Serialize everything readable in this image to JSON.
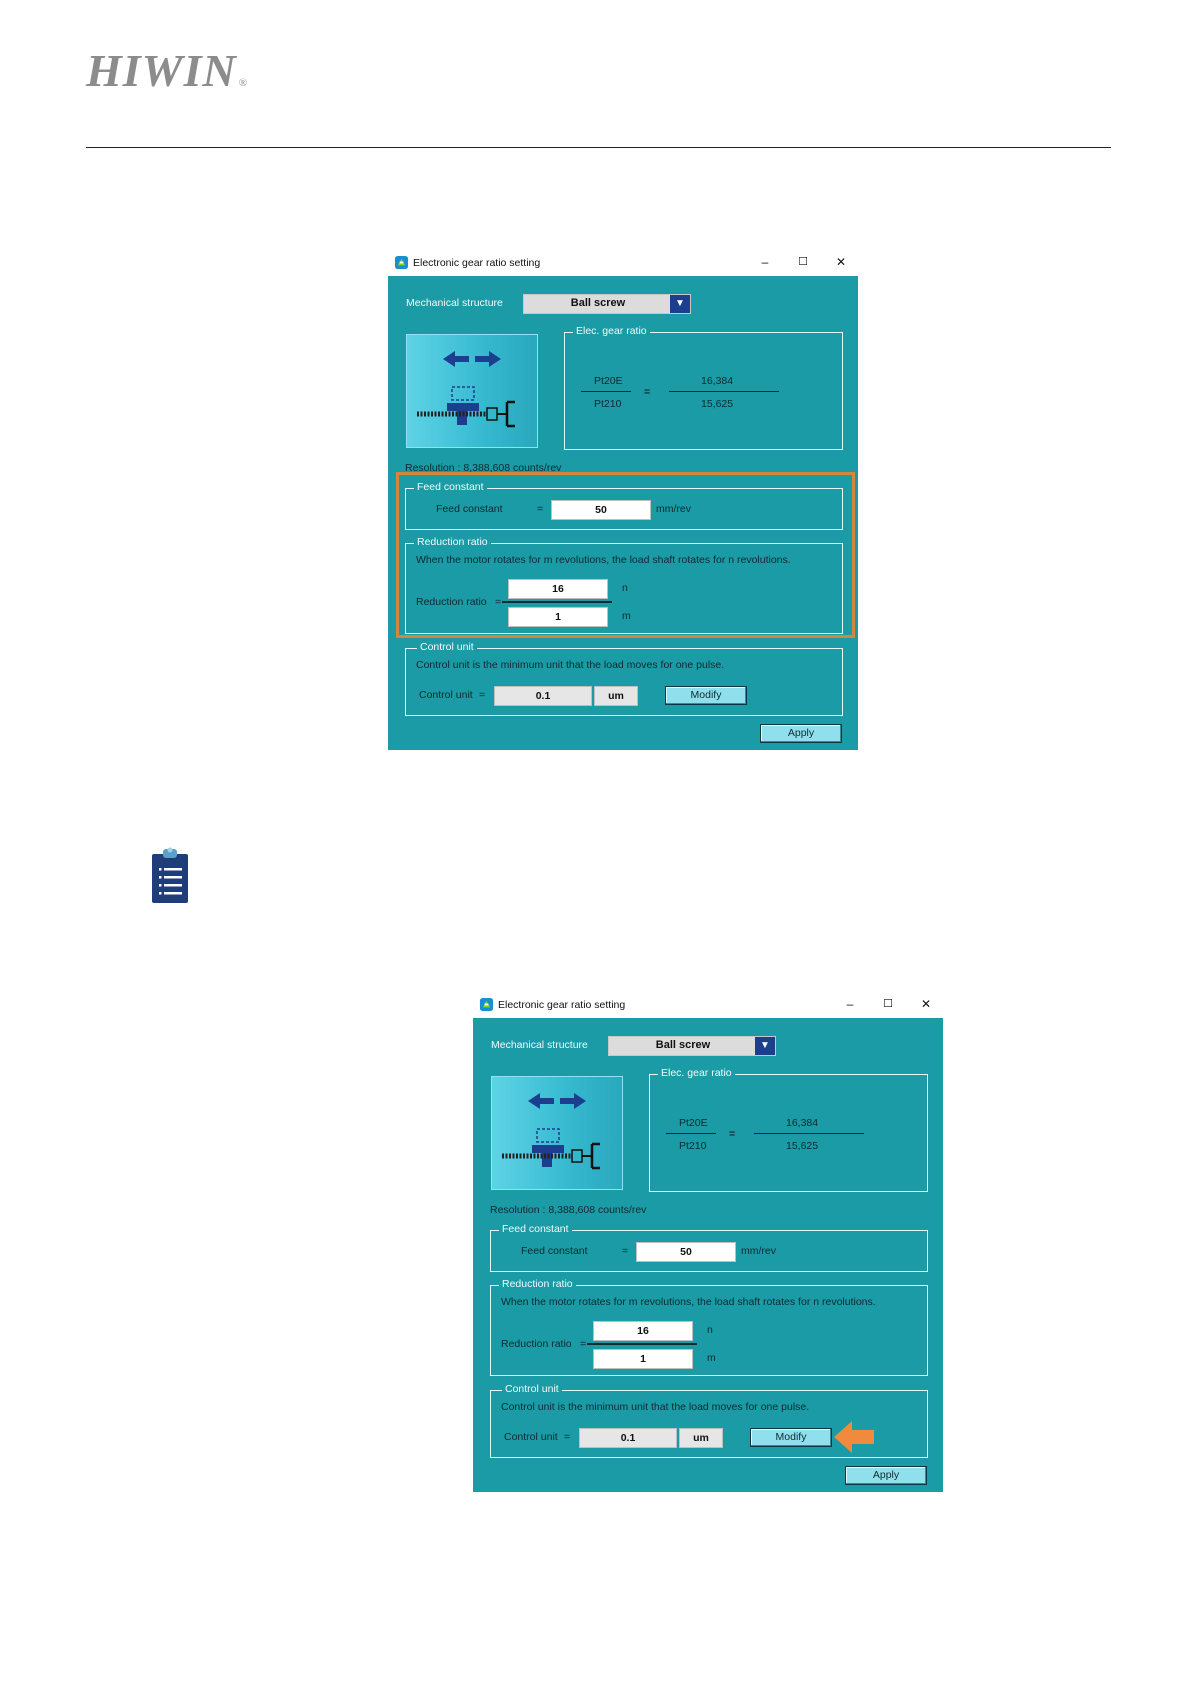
{
  "header": {
    "brand": "HIWIN",
    "brand_mark": "®"
  },
  "icons": {
    "note": "clipboard-note-icon",
    "app": "gear-ratio-app-icon"
  },
  "colors": {
    "dialog_bg": "#1a9ba5",
    "highlight": "#d4863a",
    "arrow": "#f08a3c",
    "combo_arrow": "#1b3e8e"
  },
  "dialog": {
    "title": "Electronic gear ratio setting",
    "controls": {
      "minimize": "–",
      "maximize": "☐",
      "close": "✕"
    },
    "mechanical_structure_label": "Mechanical structure",
    "mechanical_structure_value": "Ball screw",
    "elec_gear_ratio_title": "Elec. gear ratio",
    "numerator_param": "Pt20E",
    "denominator_param": "Pt210",
    "equals": "=",
    "numerator_value": "16,384",
    "denominator_value": "15,625",
    "resolution": "Resolution : 8,388,608 counts/rev",
    "feed_constant_title": "Feed constant",
    "feed_constant_label": "Feed constant",
    "feed_constant_value": "50",
    "feed_constant_unit": "mm/rev",
    "reduction_ratio_title": "Reduction ratio",
    "reduction_ratio_desc": "When the motor rotates for m revolutions, the load shaft rotates for n revolutions.",
    "reduction_ratio_label": "Reduction ratio",
    "reduction_n_value": "16",
    "reduction_n_label": "n",
    "reduction_m_value": "1",
    "reduction_m_label": "m",
    "control_unit_title": "Control unit",
    "control_unit_desc": "Control unit is the minimum unit that the load moves for one pulse.",
    "control_unit_label": "Control unit",
    "control_unit_value": "0.1",
    "control_unit_unit": "um",
    "modify_button": "Modify",
    "apply_button": "Apply"
  }
}
